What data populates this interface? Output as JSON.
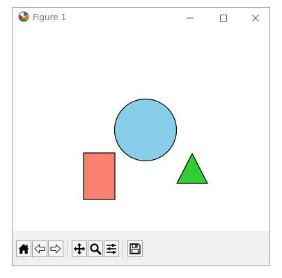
{
  "window": {
    "title": "Figure 1",
    "app_icon": "matplotlib-icon",
    "controls": {
      "minimize_icon": "minimize-icon",
      "maximize_icon": "maximize-icon",
      "close_icon": "close-icon"
    }
  },
  "figure": {
    "background": "#ffffff",
    "shapes": [
      {
        "kind": "circle",
        "fill": "#87ceeb",
        "stroke": "#000000"
      },
      {
        "kind": "rectangle",
        "fill": "#fa8072",
        "stroke": "#000000"
      },
      {
        "kind": "triangle",
        "fill": "#32cd32",
        "stroke": "#000000"
      }
    ]
  },
  "toolbar": {
    "background": "#f0f0f0",
    "buttons": [
      {
        "icon": "home-icon"
      },
      {
        "icon": "back-arrow-icon"
      },
      {
        "icon": "forward-arrow-icon"
      },
      {
        "icon": "pan-icon"
      },
      {
        "icon": "zoom-icon"
      },
      {
        "icon": "configure-subplots-icon"
      },
      {
        "icon": "save-icon"
      }
    ]
  }
}
